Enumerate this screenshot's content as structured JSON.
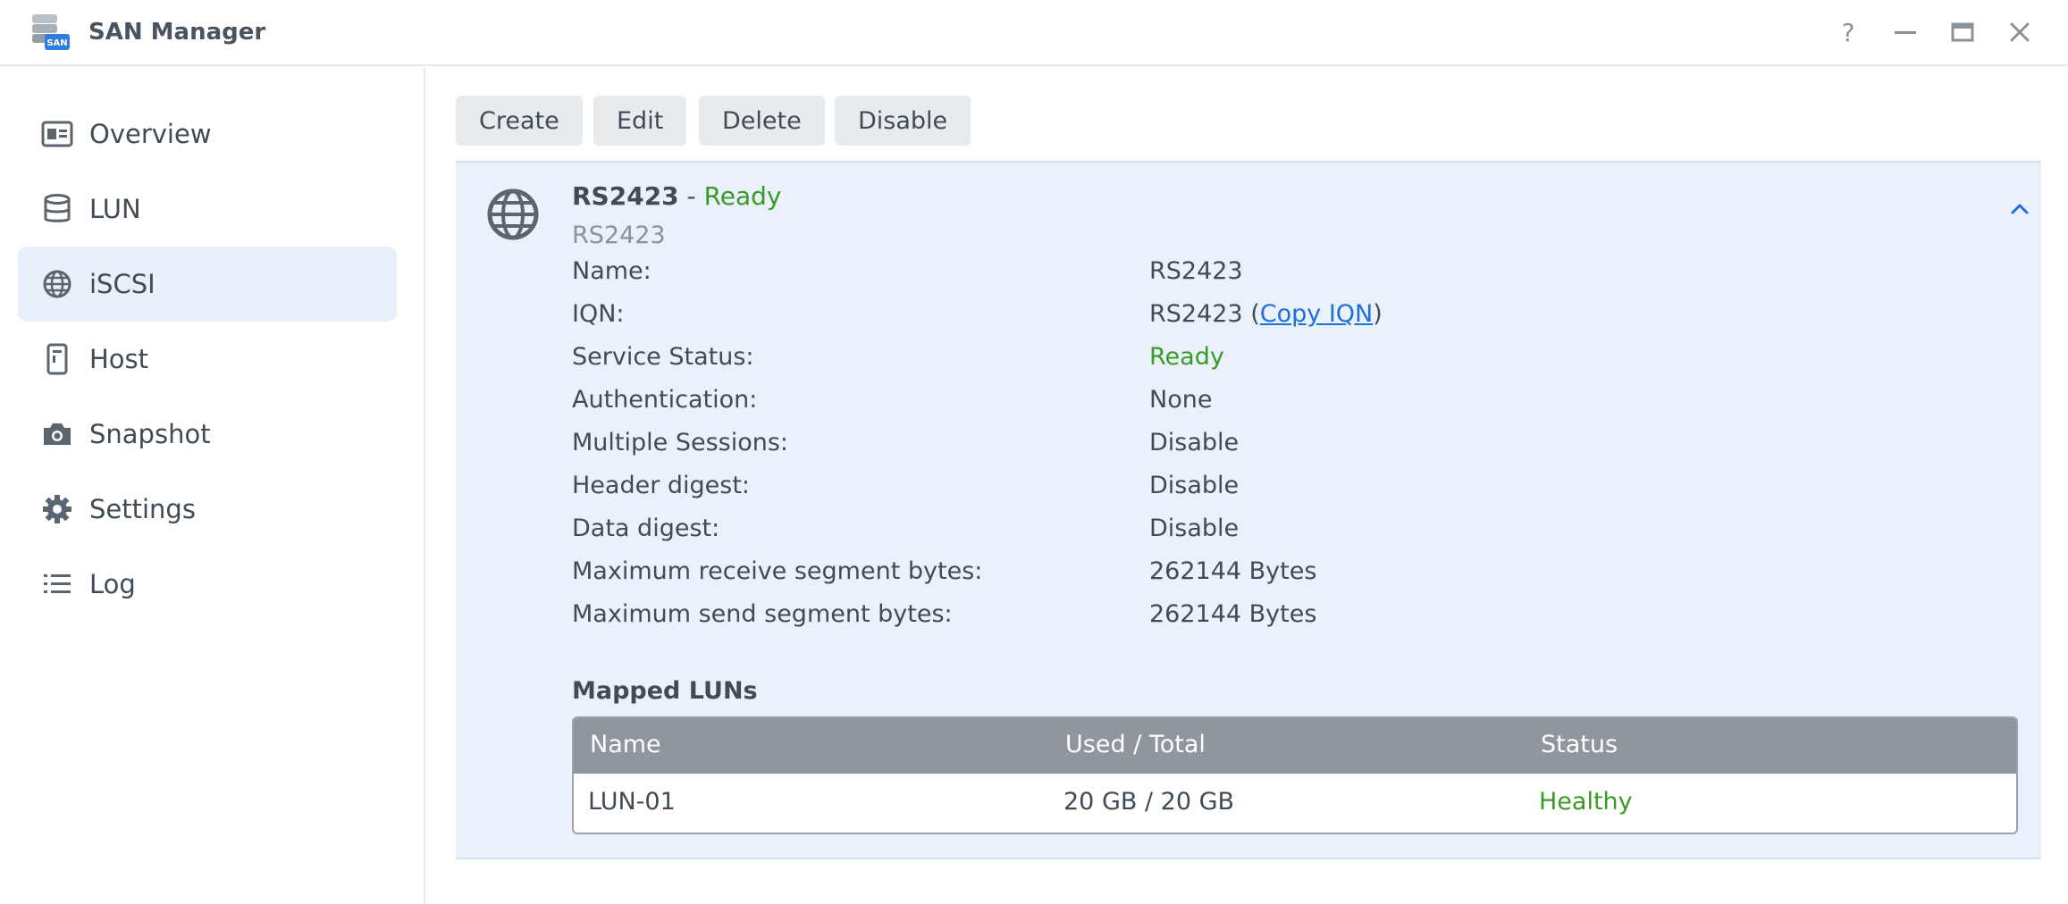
{
  "window": {
    "title": "SAN Manager",
    "app_icon_label": "SAN",
    "help_glyph": "?",
    "minimize_glyph": "—",
    "close_glyph": "✕"
  },
  "sidebar": {
    "items": [
      {
        "label": "Overview",
        "icon": "overview-icon"
      },
      {
        "label": "LUN",
        "icon": "database-icon"
      },
      {
        "label": "iSCSI",
        "icon": "globe-icon",
        "active": true
      },
      {
        "label": "Host",
        "icon": "host-icon"
      },
      {
        "label": "Snapshot",
        "icon": "camera-icon"
      },
      {
        "label": "Settings",
        "icon": "gear-icon"
      },
      {
        "label": "Log",
        "icon": "list-icon"
      }
    ]
  },
  "toolbar": {
    "create": "Create",
    "edit": "Edit",
    "delete": "Delete",
    "disable": "Disable"
  },
  "target": {
    "name": "RS2423",
    "separator": " - ",
    "status": "Ready",
    "subtitle": "RS2423",
    "properties": [
      {
        "label": "Name:",
        "value": "RS2423"
      },
      {
        "label": "IQN:",
        "value": "RS2423",
        "link": "Copy IQN"
      },
      {
        "label": "Service Status:",
        "value": "Ready"
      },
      {
        "label": "Authentication:",
        "value": "None"
      },
      {
        "label": "Multiple Sessions:",
        "value": "Disable"
      },
      {
        "label": "Header digest:",
        "value": "Disable"
      },
      {
        "label": "Data digest:",
        "value": "Disable"
      },
      {
        "label": "Maximum receive segment bytes:",
        "value": "262144 Bytes"
      },
      {
        "label": "Maximum send segment bytes:",
        "value": "262144 Bytes"
      }
    ]
  },
  "mapped_luns": {
    "title": "Mapped LUNs",
    "columns": [
      "Name",
      "Used / Total",
      "Status"
    ],
    "rows": [
      {
        "name": "LUN-01",
        "usage": "20 GB / 20 GB",
        "status": "Healthy"
      }
    ]
  },
  "colors": {
    "accent": "#1f6fd8",
    "status_green": "#3a9a28",
    "active_nav_bg": "#e8f0fb",
    "panel_bg": "#eaf1fb"
  }
}
